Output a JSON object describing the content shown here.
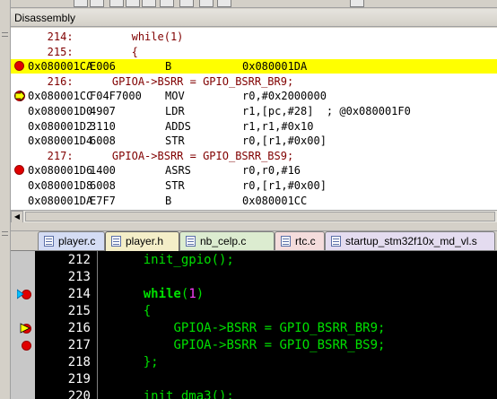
{
  "disassembly": {
    "title": "Disassembly",
    "lines": [
      {
        "kind": "src",
        "text": "   214:         while(1)"
      },
      {
        "kind": "src",
        "text": "   215:         {"
      },
      {
        "kind": "asm",
        "addr": "0x080001CA",
        "op": "E006",
        "mn": "B",
        "args": "0x080001DA",
        "current": true,
        "breakpoint": true
      },
      {
        "kind": "src",
        "text": "   216:      GPIOA->BSRR = GPIO_BSRR_BR9;"
      },
      {
        "kind": "asm",
        "addr": "0x080001CC",
        "op": "F04F7000",
        "mn": "MOV",
        "args": "r0,#0x2000000",
        "breakpoint_arrow": true
      },
      {
        "kind": "asm",
        "addr": "0x080001D0",
        "op": "4907",
        "mn": "LDR",
        "args": "r1,[pc,#28]  ; @0x080001F0"
      },
      {
        "kind": "asm",
        "addr": "0x080001D2",
        "op": "3110",
        "mn": "ADDS",
        "args": "r1,r1,#0x10"
      },
      {
        "kind": "asm",
        "addr": "0x080001D4",
        "op": "6008",
        "mn": "STR",
        "args": "r0,[r1,#0x00]"
      },
      {
        "kind": "src",
        "text": "   217:      GPIOA->BSRR = GPIO_BSRR_BS9;"
      },
      {
        "kind": "asm",
        "addr": "0x080001D6",
        "op": "1400",
        "mn": "ASRS",
        "args": "r0,r0,#16",
        "breakpoint": true
      },
      {
        "kind": "asm",
        "addr": "0x080001D8",
        "op": "6008",
        "mn": "STR",
        "args": "r0,[r1,#0x00]"
      },
      {
        "kind": "asm",
        "addr": "0x080001DA",
        "op": "E7F7",
        "mn": "B",
        "args": "0x080001CC"
      }
    ]
  },
  "tabs": [
    {
      "label": "player.c",
      "active": false,
      "color": "#d4dcf4"
    },
    {
      "label": "player.h",
      "active": true,
      "color": "#f4eec8"
    },
    {
      "label": "nb_celp.c",
      "active": false,
      "color": "#dcecd0"
    },
    {
      "label": "rtc.c",
      "active": false,
      "color": "#f4dcdc"
    },
    {
      "label": "startup_stm32f10x_md_vl.s",
      "active": false,
      "color": "#e4dcf0"
    }
  ],
  "editor": {
    "lines": [
      {
        "num": "212",
        "code": "init_gpio();",
        "indent": "    "
      },
      {
        "num": "213",
        "code": ""
      },
      {
        "num": "214",
        "code_kw": "while",
        "code_rest": "(",
        "code_num": "1",
        "code_end": ")",
        "indent": "    ",
        "marker": "arrow-breakpoint"
      },
      {
        "num": "215",
        "code": "{",
        "indent": "    "
      },
      {
        "num": "216",
        "code": "GPIOA->BSRR = GPIO_BSRR_BR9;",
        "indent": "        ",
        "marker": "arrow-current"
      },
      {
        "num": "217",
        "code": "GPIOA->BSRR = GPIO_BSRR_BS9;",
        "indent": "        ",
        "marker": "breakpoint"
      },
      {
        "num": "218",
        "code": "};",
        "indent": "    "
      },
      {
        "num": "219",
        "code": ""
      },
      {
        "num": "220",
        "code": "init_dma3();",
        "indent": "    "
      }
    ]
  },
  "colors": {
    "current_line": "#ffff00",
    "breakpoint": "#e00000",
    "editor_bg": "#000000",
    "code_text": "#00e000",
    "number": "#ff40ff"
  }
}
